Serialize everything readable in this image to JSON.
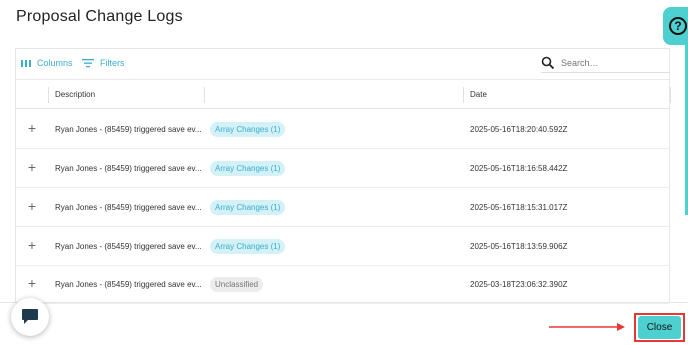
{
  "modal": {
    "title": "Proposal Change Logs"
  },
  "help": {
    "label": "?"
  },
  "toolbar": {
    "columns_label": "Columns",
    "filters_label": "Filters",
    "search_placeholder": "Search…"
  },
  "table": {
    "columns": [
      "Description",
      "",
      "Date"
    ],
    "rows": [
      {
        "description": "Ryan Jones - (85459) triggered save ev...",
        "tag": "Array Changes (1)",
        "date": "2025-05-16T18:20:40.592Z"
      },
      {
        "description": "Ryan Jones - (85459) triggered save ev...",
        "tag": "Array Changes (1)",
        "date": "2025-05-16T18:16:58.442Z"
      },
      {
        "description": "Ryan Jones - (85459) triggered save ev...",
        "tag": "Array Changes (1)",
        "date": "2025-05-16T18:15:31.017Z"
      },
      {
        "description": "Ryan Jones - (85459) triggered save ev...",
        "tag": "Array Changes (1)",
        "date": "2025-05-16T18:13:59.906Z"
      },
      {
        "description": "Ryan Jones - (85459) triggered save ev...",
        "tag": "Unclassified",
        "date": "2025-03-18T23:06:32.390Z"
      }
    ],
    "expand_symbol": "+"
  },
  "footer": {
    "close_label": "Close"
  },
  "colors": {
    "accent": "#4dd0cf",
    "link": "#3aaecf",
    "tag_bg": "#d3f1f6",
    "highlight": "#e53935"
  }
}
